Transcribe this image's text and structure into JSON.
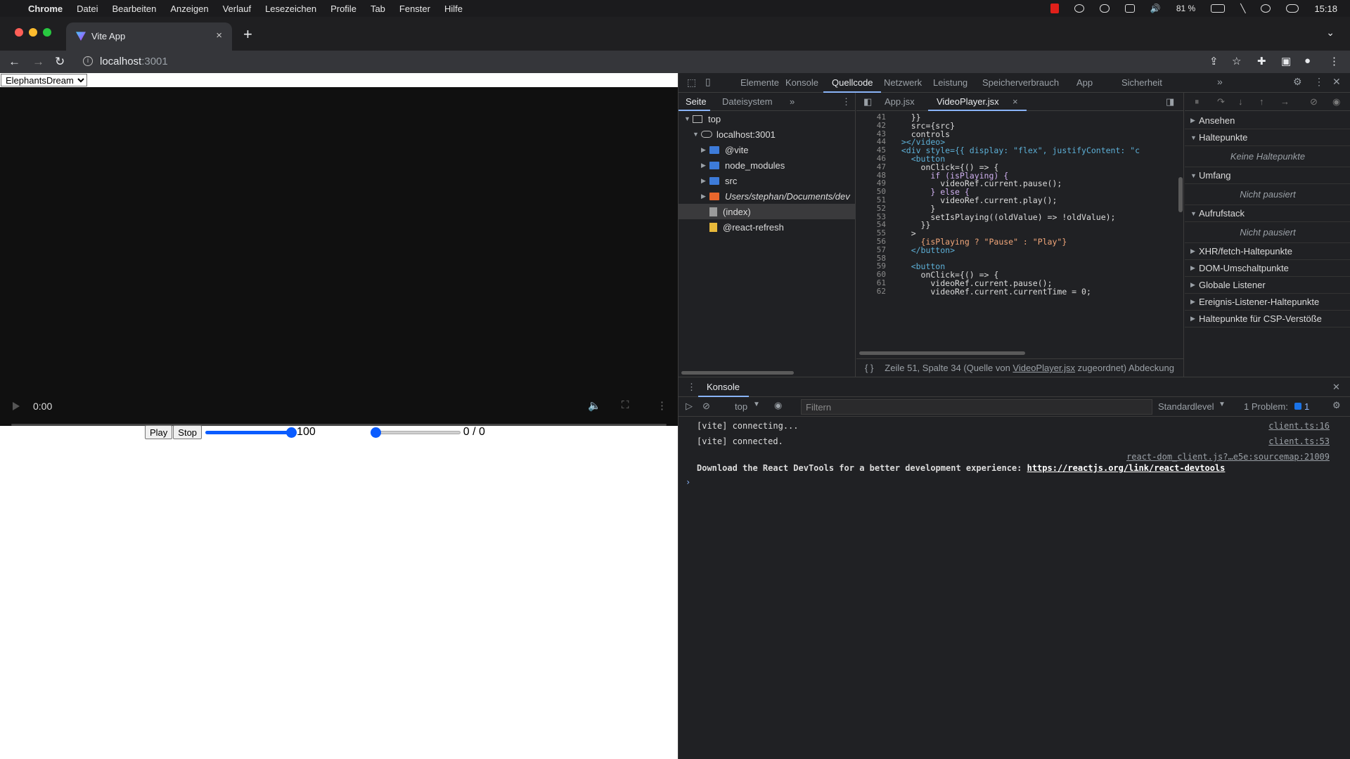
{
  "menubar": {
    "items": [
      "Chrome",
      "Datei",
      "Bearbeiten",
      "Anzeigen",
      "Verlauf",
      "Lesezeichen",
      "Profile",
      "Tab",
      "Fenster",
      "Hilfe"
    ],
    "battery": "81 %",
    "clock": "15:18"
  },
  "tab": {
    "title": "Vite App",
    "close": "×"
  },
  "address": {
    "host": "localhost",
    "port": ":3001"
  },
  "page": {
    "select_value": "ElephantsDream",
    "video_time": "0:00",
    "play_label": "Play",
    "stop_label": "Stop",
    "volume_value": "100",
    "volume_level": 1.0,
    "seek_value": "0 / 0",
    "seek_level": 0.0
  },
  "devtools": {
    "tabs": [
      "Elemente",
      "Konsole",
      "Quellcode",
      "Netzwerk",
      "Leistung",
      "Speicherverbrauch",
      "App",
      "Sicherheit"
    ],
    "active_tab": "Quellcode",
    "nav_tabs": [
      "Seite",
      "Dateisystem"
    ],
    "tree": [
      {
        "label": "top",
        "indent": 0,
        "type": "frame"
      },
      {
        "label": "localhost:3001",
        "indent": 1,
        "type": "cloud"
      },
      {
        "label": "@vite",
        "indent": 2,
        "type": "folder"
      },
      {
        "label": "node_modules",
        "indent": 2,
        "type": "folder"
      },
      {
        "label": "src",
        "indent": 2,
        "type": "folder"
      },
      {
        "label": "Users/stephan/Documents/dev",
        "indent": 2,
        "type": "folder-orange"
      },
      {
        "label": "(index)",
        "indent": 2,
        "type": "file-grey"
      },
      {
        "label": "@react-refresh",
        "indent": 2,
        "type": "file-yellow"
      }
    ],
    "editor_tabs": [
      "App.jsx",
      "VideoPlayer.jsx"
    ],
    "active_editor_tab": "VideoPlayer.jsx",
    "status_line": "Zeile 51, Spalte 34  (Quelle von ",
    "status_link": "VideoPlayer.jsx",
    "status_tail": " zugeordnet)  Abdeckung",
    "code": [
      {
        "n": "41",
        "t": "    }}"
      },
      {
        "n": "42",
        "t": "    src={src}"
      },
      {
        "n": "43",
        "t": "    controls"
      },
      {
        "n": "44",
        "t": "  ></video>"
      },
      {
        "n": "45",
        "t": "  <div style={{ display: \"flex\", justifyContent: \"c"
      },
      {
        "n": "46",
        "t": "    <button"
      },
      {
        "n": "47",
        "t": "      onClick={() => {"
      },
      {
        "n": "48",
        "t": "        if (isPlaying) {"
      },
      {
        "n": "49",
        "t": "          videoRef.current.pause();"
      },
      {
        "n": "50",
        "t": "        } else {"
      },
      {
        "n": "51",
        "t": "          videoRef.current.play();"
      },
      {
        "n": "52",
        "t": "        }"
      },
      {
        "n": "53",
        "t": "        setIsPlaying((oldValue) => !oldValue);"
      },
      {
        "n": "54",
        "t": "      }}"
      },
      {
        "n": "55",
        "t": "    >"
      },
      {
        "n": "56",
        "t": "      {isPlaying ? \"Pause\" : \"Play\"}"
      },
      {
        "n": "57",
        "t": "    </button>"
      },
      {
        "n": "58",
        "t": ""
      },
      {
        "n": "59",
        "t": "    <button"
      },
      {
        "n": "60",
        "t": "      onClick={() => {"
      },
      {
        "n": "61",
        "t": "        videoRef.current.pause();"
      },
      {
        "n": "62",
        "t": "        videoRef.current.currentTime = 0;"
      }
    ],
    "debugger": {
      "sections": [
        "Ansehen",
        "Haltepunkte",
        "Umfang",
        "Aufrufstack",
        "XHR/fetch-Haltepunkte",
        "DOM-Umschaltpunkte",
        "Globale Listener",
        "Ereignis-Listener-Haltepunkte",
        "Haltepunkte für CSP-Verstöße"
      ],
      "no_breakpoints": "Keine Haltepunkte",
      "not_paused": "Nicht pausiert"
    },
    "console": {
      "title": "Konsole",
      "context": "top",
      "filter_placeholder": "Filtern",
      "level": "Standardlevel",
      "problems": "1 Problem:",
      "problem_count": "1",
      "messages": [
        {
          "text": "[vite] connecting...",
          "src": "client.ts:16"
        },
        {
          "text": "[vite] connected.",
          "src": "client.ts:53"
        }
      ],
      "react_src": "react-dom_client.js?…e5e:sourcemap:21009",
      "react_text": "Download the React DevTools for a better development experience: ",
      "react_link": "https://reactjs.org/link/react-devtools"
    }
  },
  "colors": {
    "accent": "#8ab4f8",
    "range": "#0a5cff",
    "folder": "#3d7bd9"
  }
}
